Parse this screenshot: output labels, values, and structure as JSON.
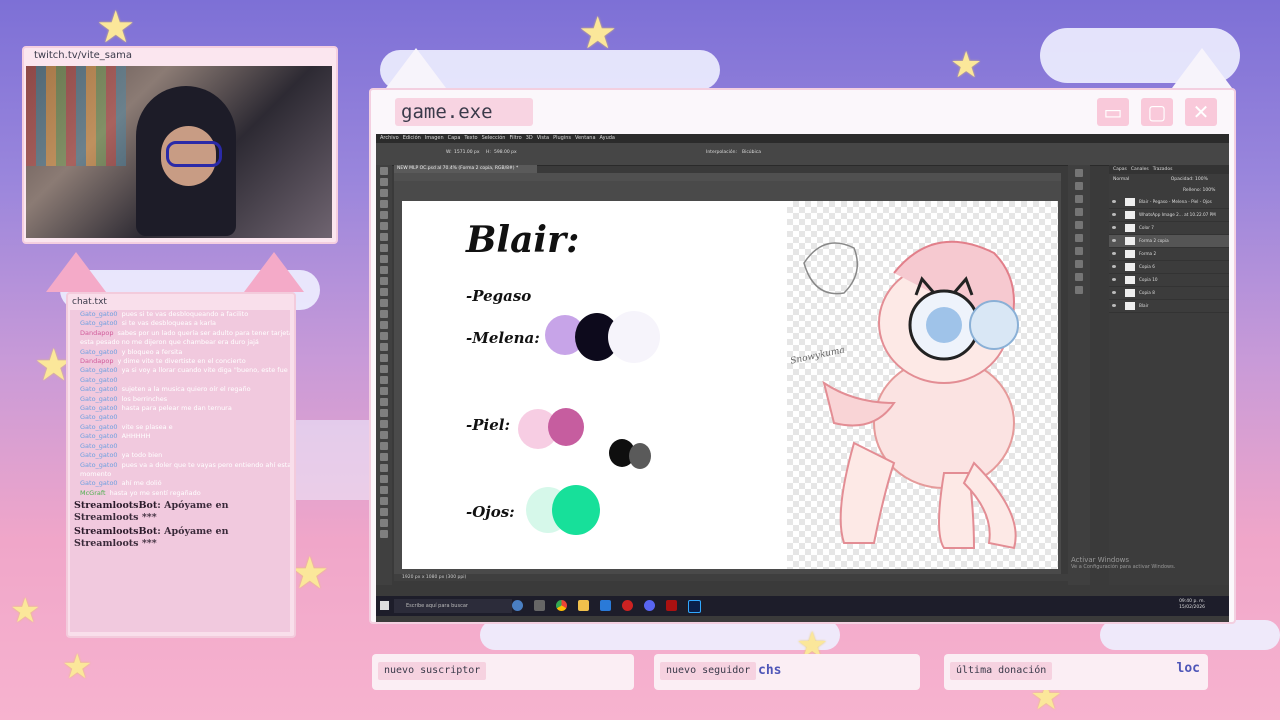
{
  "webcam": {
    "url": "twitch.tv/vite_sama"
  },
  "chat": {
    "title": "chat.txt",
    "messages": [
      {
        "user": "Gato_gato0",
        "text": "pues si te vas desbloqueando a facilito",
        "cls": ""
      },
      {
        "user": "Gato_gato0",
        "text": "si te vas desbloqueas a karla",
        "cls": ""
      },
      {
        "user": "Dandapop",
        "text": "sabes por un lado quería ser adulto para tener tarjeta y no andar pidiendo prestado",
        "cls": "pink"
      },
      {
        "user": "",
        "text": "esta pesado no me dijeron que chambear era duro jajá",
        "cls": ""
      },
      {
        "user": "Gato_gato0",
        "text": "y bloqueo a fersita",
        "cls": ""
      },
      {
        "user": "Dandapop",
        "text": "y dime vite te divertiste en el concierto",
        "cls": "pink"
      },
      {
        "user": "Gato_gato0",
        "text": "ya si voy a llorar cuando vite diga \"bueno, este fue nuestro último stream\"",
        "cls": ""
      },
      {
        "user": "Gato_gato0",
        "text": "",
        "cls": ""
      },
      {
        "user": "Gato_gato0",
        "text": "sujeten a la musica quiero oír el regaño",
        "cls": ""
      },
      {
        "user": "Gato_gato0",
        "text": "los berrinches",
        "cls": ""
      },
      {
        "user": "Gato_gato0",
        "text": "hasta para pelear me dan ternura",
        "cls": ""
      },
      {
        "user": "Gato_gato0",
        "text": "",
        "cls": ""
      },
      {
        "user": "Gato_gato0",
        "text": "vite se plasea e",
        "cls": ""
      },
      {
        "user": "Gato_gato0",
        "text": "AHHHHH",
        "cls": ""
      },
      {
        "user": "Gato_gato0",
        "text": "",
        "cls": ""
      },
      {
        "user": "Gato_gato0",
        "text": "ya todo bien",
        "cls": ""
      },
      {
        "user": "Gato_gato0",
        "text": "pues va a doler que te vayas pero entiendo ahí estaré por si regresa en algún",
        "cls": ""
      },
      {
        "user": "",
        "text": "momento",
        "cls": ""
      },
      {
        "user": "Gato_gato0",
        "text": "ahí me dolió",
        "cls": ""
      },
      {
        "user": "McGraft",
        "text": "hasta yo me sentí regañado",
        "cls": "green"
      }
    ],
    "bot_messages": [
      {
        "name": "StreamlootsBot",
        "text": ": Apóyame en Streamloots ***"
      },
      {
        "name": "StreamlootsBot",
        "text": ": Apóyame en Streamloots ***"
      }
    ]
  },
  "game_window": {
    "title": "game.exe",
    "minimize": "▭",
    "maximize": "▢",
    "close": "✕"
  },
  "photoshop": {
    "menu": [
      "Archivo",
      "Edición",
      "Imagen",
      "Capa",
      "Texto",
      "Selección",
      "Filtro",
      "3D",
      "Vista",
      "Plugins",
      "Ventana",
      "Ayuda"
    ],
    "doc_tab": "NEW MLP OC.psd al 70.4% (Forma 2 copia, RGB/8#) *",
    "options": [
      "W:",
      "1571.00 px",
      "H:",
      "598.00 px",
      "Interpolación:",
      "Bicúbica"
    ],
    "panel_tabs": [
      "Capas",
      "Canales",
      "Trazados"
    ],
    "blend": "Normal",
    "opacity": "Opacidad: 100%",
    "fill": "Relleno: 100%",
    "layers": [
      {
        "name": "Blair - Pegaso - Melena - Piel - Ojos",
        "sel": false
      },
      {
        "name": "WhatsApp Image 2... at 10.22.07 PM",
        "sel": false
      },
      {
        "name": "Color 7",
        "sel": false
      },
      {
        "name": "Forma 2 copia",
        "sel": true
      },
      {
        "name": "Forma 2",
        "sel": false
      },
      {
        "name": "Copia 6",
        "sel": false
      },
      {
        "name": "Copia 10",
        "sel": false
      },
      {
        "name": "Copia 8",
        "sel": false
      },
      {
        "name": "Blair",
        "sel": false
      }
    ],
    "status": "1920 px x 1080 px (300 ppi)",
    "activate_title": "Activar Windows",
    "activate_sub": "Ve a Configuración para activar Windows.",
    "taskbar_search": "Escribe aquí para buscar",
    "time": "09:40 p. m.",
    "date": "15/02/2026"
  },
  "sheet": {
    "title": "Blair:",
    "labels": [
      "-Pegaso",
      "-Melena:",
      "-Piel:",
      "-Ojos:"
    ],
    "watermark": "Snowykuma",
    "colors": {
      "melena": [
        "#c7a4e8",
        "#0d0a1c",
        "#f6f4fb"
      ],
      "piel": [
        "#f7cde3",
        "#c65d9f"
      ],
      "extra": [
        "#0f0f0f",
        "#5a5a5a"
      ],
      "ojos": [
        "#d6f8ea",
        "#17e09a"
      ]
    }
  },
  "alerts": [
    {
      "label": "nuevo suscriptor",
      "value": ""
    },
    {
      "label": "nuevo seguidor",
      "value": "chs"
    },
    {
      "label": "última donación",
      "value": "loc"
    }
  ]
}
